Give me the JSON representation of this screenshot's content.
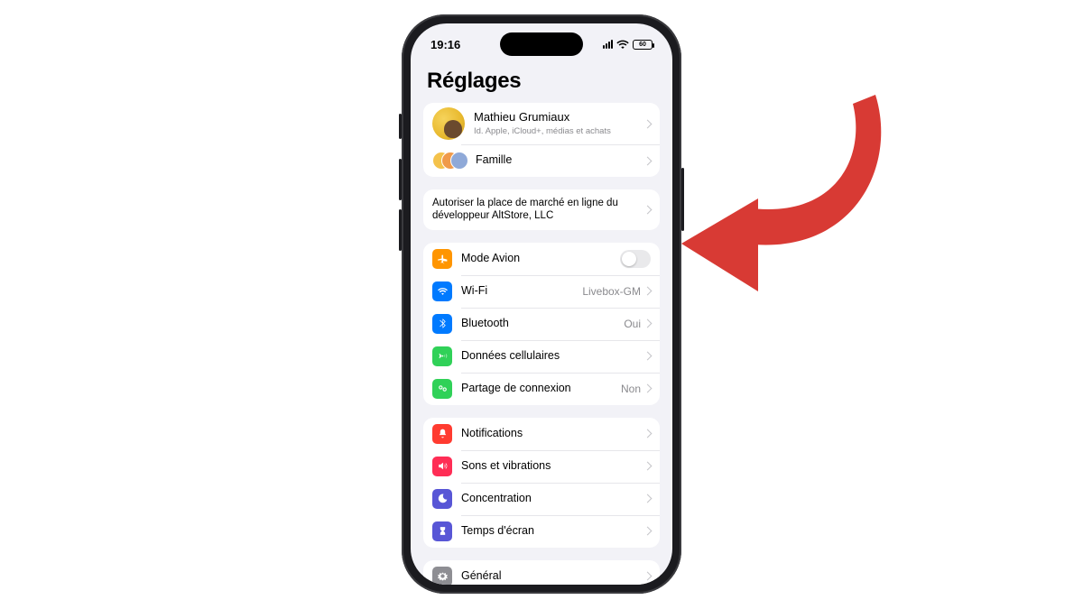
{
  "statusbar": {
    "time": "19:16",
    "battery": "60"
  },
  "title": "Réglages",
  "account": {
    "name": "Mathieu Grumiaux",
    "subtitle": "Id. Apple, iCloud+, médias et achats",
    "family_label": "Famille"
  },
  "marketplace": {
    "text": "Autoriser la place de marché en ligne du développeur AltStore, LLC"
  },
  "connectivity": {
    "airplane": "Mode Avion",
    "wifi": {
      "label": "Wi-Fi",
      "value": "Livebox-GM"
    },
    "bluetooth": {
      "label": "Bluetooth",
      "value": "Oui"
    },
    "cellular": "Données cellulaires",
    "hotspot": {
      "label": "Partage de connexion",
      "value": "Non"
    }
  },
  "system": {
    "notifications": "Notifications",
    "sounds": "Sons et vibrations",
    "focus": "Concentration",
    "screentime": "Temps d'écran"
  },
  "general": {
    "label": "Général"
  }
}
